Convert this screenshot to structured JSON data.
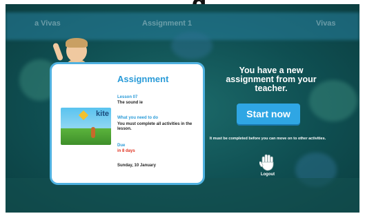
{
  "header": {
    "cut_title": "g"
  },
  "background": {
    "label_left": "a Vivas",
    "label_mid": "Assignment 1",
    "label_right": "Vivas"
  },
  "card": {
    "title": "Assignment",
    "lesson_label": "Lesson 07",
    "lesson_sound": "The sound ie",
    "need_label": "What you need to do",
    "need_text": "You must complete all activities in the lesson.",
    "due_label": "Due",
    "due_days": "in 8 days",
    "due_date": "Sunday, 10 January",
    "thumbnail_word": "kite"
  },
  "panel": {
    "headline": "You have a new assignment from your teacher.",
    "start_label": "Start now",
    "note": "It must be completed before you can move on to other activities.",
    "logout_label": "Logout",
    "logout_icon": "hand-icon"
  },
  "colors": {
    "accent": "#2fa6e4",
    "title": "#2a9bd8",
    "due": "#e0301e",
    "background": "#0f4f52"
  }
}
